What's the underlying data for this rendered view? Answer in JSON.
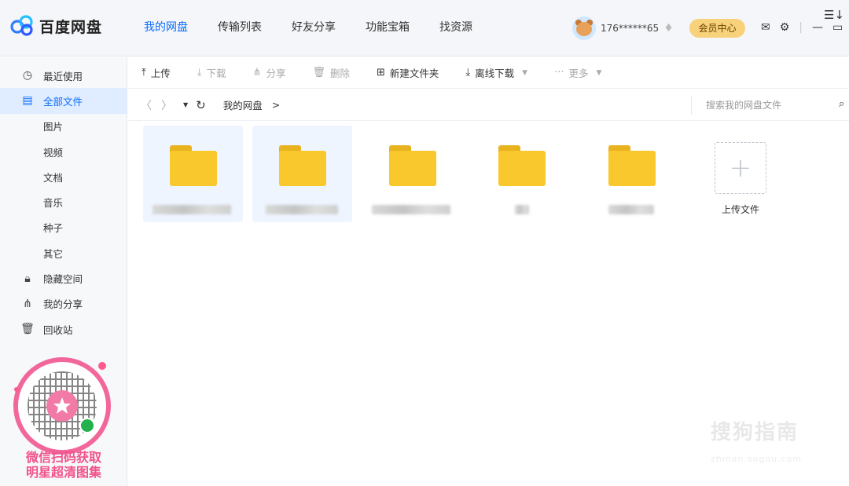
{
  "app": {
    "name": "百度网盘"
  },
  "nav": {
    "items": [
      {
        "label": "我的网盘",
        "active": true
      },
      {
        "label": "传输列表",
        "active": false
      },
      {
        "label": "好友分享",
        "active": false
      },
      {
        "label": "功能宝箱",
        "active": false
      },
      {
        "label": "找资源",
        "active": false
      }
    ]
  },
  "user": {
    "name": "176******65",
    "vip_button": "会员中心"
  },
  "sidebar": {
    "items": [
      {
        "label": "最近使用",
        "icon": "clock-icon"
      },
      {
        "label": "全部文件",
        "icon": "document-icon",
        "active": true
      },
      {
        "label": "图片"
      },
      {
        "label": "视频"
      },
      {
        "label": "文档"
      },
      {
        "label": "音乐"
      },
      {
        "label": "种子"
      },
      {
        "label": "其它"
      },
      {
        "label": "隐藏空间",
        "icon": "lock-icon"
      },
      {
        "label": "我的分享",
        "icon": "share-icon"
      },
      {
        "label": "回收站",
        "icon": "trash-icon"
      }
    ],
    "promo_line1": "微信扫码获取",
    "promo_line2": "明星超清图集"
  },
  "toolbar": {
    "upload": "上传",
    "download": "下载",
    "share": "分享",
    "delete": "删除",
    "new_folder": "新建文件夹",
    "offline_download": "离线下载",
    "more": "更多"
  },
  "address": {
    "breadcrumb": "我的网盘",
    "separator": ">",
    "search_placeholder": "搜索我的网盘文件"
  },
  "files": {
    "upload_label": "上传文件"
  },
  "watermark": {
    "text": "搜狗指南",
    "sub": "zhinan.sogou.com"
  },
  "colors": {
    "accent": "#0a6cff",
    "folder": "#f8c82c",
    "vip": "#f8d27a",
    "promo": "#f2528b"
  }
}
